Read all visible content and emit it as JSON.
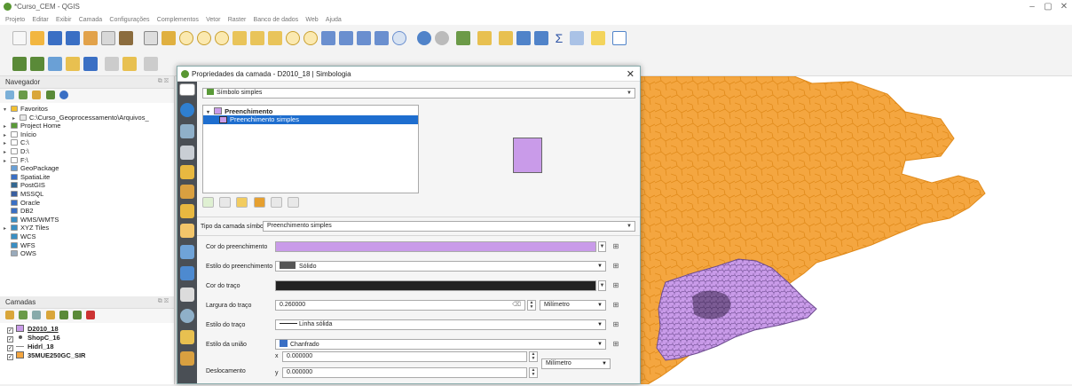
{
  "window": {
    "title": "*Curso_CEM - QGIS",
    "controls": [
      "–",
      "▢",
      "✕"
    ]
  },
  "menubar": {
    "items": [
      "Projeto",
      "Editar",
      "Exibir",
      "Camada",
      "Configurações",
      "Complementos",
      "Vetor",
      "Raster",
      "Banco de dados",
      "Web",
      "Ajuda"
    ]
  },
  "browser_panel": {
    "title": "Navegador",
    "controls": "⧉ ☒",
    "items": [
      {
        "label": "Favoritos",
        "icon": "star-icon",
        "expander": "▾",
        "indent": 0
      },
      {
        "label": "C:\\Curso_Geoprocessamento\\Arquivos_",
        "icon": "folder-icon",
        "expander": "▸",
        "indent": 1
      },
      {
        "label": "Project Home",
        "icon": "project-home-icon",
        "expander": "▸",
        "indent": 0
      },
      {
        "label": "Início",
        "icon": "home-icon",
        "expander": "▸",
        "indent": 0
      },
      {
        "label": "C:\\",
        "icon": "drive-icon",
        "expander": "▸",
        "indent": 0
      },
      {
        "label": "D:\\",
        "icon": "drive-icon",
        "expander": "▸",
        "indent": 0
      },
      {
        "label": "F:\\",
        "icon": "drive-icon",
        "expander": "▸",
        "indent": 0
      },
      {
        "label": "GeoPackage",
        "icon": "geopackage-icon",
        "expander": "",
        "indent": 0
      },
      {
        "label": "SpatiaLite",
        "icon": "spatialite-icon",
        "expander": "",
        "indent": 0
      },
      {
        "label": "PostGIS",
        "icon": "postgis-icon",
        "expander": "",
        "indent": 0
      },
      {
        "label": "MSSQL",
        "icon": "mssql-icon",
        "expander": "",
        "indent": 0
      },
      {
        "label": "Oracle",
        "icon": "oracle-icon",
        "expander": "",
        "indent": 0
      },
      {
        "label": "DB2",
        "icon": "db2-icon",
        "expander": "",
        "indent": 0
      },
      {
        "label": "WMS/WMTS",
        "icon": "wms-icon",
        "expander": "",
        "indent": 0
      },
      {
        "label": "XYZ Tiles",
        "icon": "xyz-tiles-icon",
        "expander": "▸",
        "indent": 0
      },
      {
        "label": "WCS",
        "icon": "wcs-icon",
        "expander": "",
        "indent": 0
      },
      {
        "label": "WFS",
        "icon": "wfs-icon",
        "expander": "",
        "indent": 0
      },
      {
        "label": "OWS",
        "icon": "ows-icon",
        "expander": "",
        "indent": 0
      }
    ]
  },
  "layers_panel": {
    "title": "Camadas",
    "controls": "⧉ ☒",
    "layers": [
      {
        "name": "D2010_18",
        "checked": "✓",
        "color": "#c99be9",
        "style": "fill"
      },
      {
        "name": "ShopC_16",
        "checked": "✓",
        "color": "#555555",
        "style": "point"
      },
      {
        "name": "Hidrl_18",
        "checked": "✓",
        "color": "#888888",
        "style": "line"
      },
      {
        "name": "35MUE250GC_SIR",
        "checked": "✓",
        "color": "#f4a640",
        "style": "fill"
      }
    ]
  },
  "dialog": {
    "title": "Propriedades da camada - D2010_18 | Simbologia",
    "close": "✕",
    "renderer": "Símbolo simples",
    "symbol_tree": {
      "root": "Preenchimento",
      "child": "Preenchimento simples"
    },
    "symbol_layer_type_label": "Tipo da camada símbolo",
    "symbol_layer_type": "Preenchimento simples",
    "fields": {
      "fill_color_label": "Cor do preenchimento",
      "fill_color": "#c99be9",
      "fill_style_label": "Estilo do preenchimento",
      "fill_style": "Sólido",
      "stroke_color_label": "Cor do traço",
      "stroke_color": "#222222",
      "stroke_width_label": "Largura do traço",
      "stroke_width": "0.260000",
      "stroke_width_unit": "Milímetro",
      "stroke_style_label": "Estilo do traço",
      "stroke_style": "Linha sólida",
      "join_style_label": "Estilo da união",
      "join_style": "Chanfrado",
      "offset_label": "Deslocamento",
      "offset_x_label": "x",
      "offset_x": "0.000000",
      "offset_y_label": "y",
      "offset_y": "0.000000",
      "offset_unit": "Milímetro"
    }
  },
  "colors": {
    "map_fill": "#f4a640",
    "map_stroke": "#e08a1a",
    "selection_fill": "#c99be9",
    "qgis_green": "#589632"
  }
}
